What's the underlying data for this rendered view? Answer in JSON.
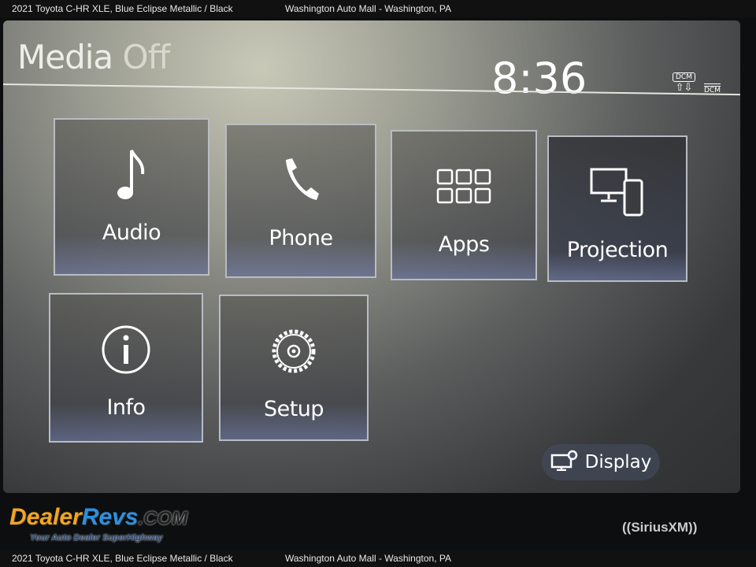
{
  "caption": {
    "vehicle": "2021 Toyota C-HR XLE,  Blue Eclipse Metallic / Black",
    "dealer": "Washington Auto Mall - Washington, PA"
  },
  "header": {
    "title_a": "Media",
    "title_b": "Off",
    "clock": "8:36",
    "dcm_label": "DCM",
    "dcm_arrows": "⇧⇩",
    "dcm_signal": "DCM"
  },
  "tiles": [
    {
      "label": "Audio",
      "icon": "music-note-icon"
    },
    {
      "label": "Phone",
      "icon": "phone-icon"
    },
    {
      "label": "Apps",
      "icon": "apps-grid-icon"
    },
    {
      "label": "Projection",
      "icon": "monitor-phone-icon"
    },
    {
      "label": "Info",
      "icon": "info-icon"
    },
    {
      "label": "Setup",
      "icon": "gear-icon"
    }
  ],
  "display_button": {
    "label": "Display",
    "icon": "display-settings-icon"
  },
  "watermark": {
    "brand_a": "Dealer",
    "brand_b": "Revs",
    ".com": ".COM",
    "tagline": "Your Auto Dealer SuperHighway"
  },
  "bezel": {
    "siriusxm": "((SiriusXM))"
  }
}
